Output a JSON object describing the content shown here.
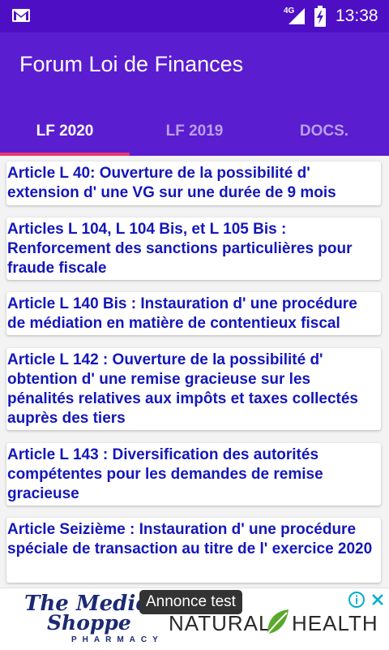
{
  "status_bar": {
    "network": "4G",
    "time": "13:38",
    "icons": [
      "gmail-icon",
      "signal-icon",
      "battery-charging-icon"
    ]
  },
  "app": {
    "title": "Forum Loi de Finances"
  },
  "tabs": [
    {
      "label": "LF 2020",
      "active": true
    },
    {
      "label": "LF 2019",
      "active": false
    },
    {
      "label": "DOCS.",
      "active": false
    }
  ],
  "colors": {
    "status_bar": "#4e0fc4",
    "app_bar": "#5b1dd0",
    "tab_indicator": "#e8366f",
    "item_text": "#1417b8"
  },
  "articles": [
    {
      "title": "Article L 40: Ouverture de la possibilité d' extension d' une VG sur une durée de 9 mois"
    },
    {
      "title": "Articles L 104, L 104 Bis, et L 105 Bis : Renforcement des sanctions particulières pour fraude fiscale"
    },
    {
      "title": "Article L 140 Bis : Instauration d' une procédure de médiation en matière de contentieux fiscal"
    },
    {
      "title": "Article L 142 : Ouverture de la possibilité d' obtention d' une remise gracieuse sur les pénalités relatives aux impôts et taxes collectés auprès des tiers"
    },
    {
      "title": "Article L 143 : Diversification des autorités compétentes pour les demandes de remise gracieuse"
    },
    {
      "title": "Article Seizième : Instauration d' une procédure spéciale de transaction au titre de l' exercice 2020"
    }
  ],
  "ad": {
    "badge": "Annonce test",
    "brand_line1": "The Medicine",
    "brand_line2": "Shoppe",
    "brand_sub": "PHARMACY",
    "natural": "NATURAL",
    "health": "HEALTH"
  }
}
